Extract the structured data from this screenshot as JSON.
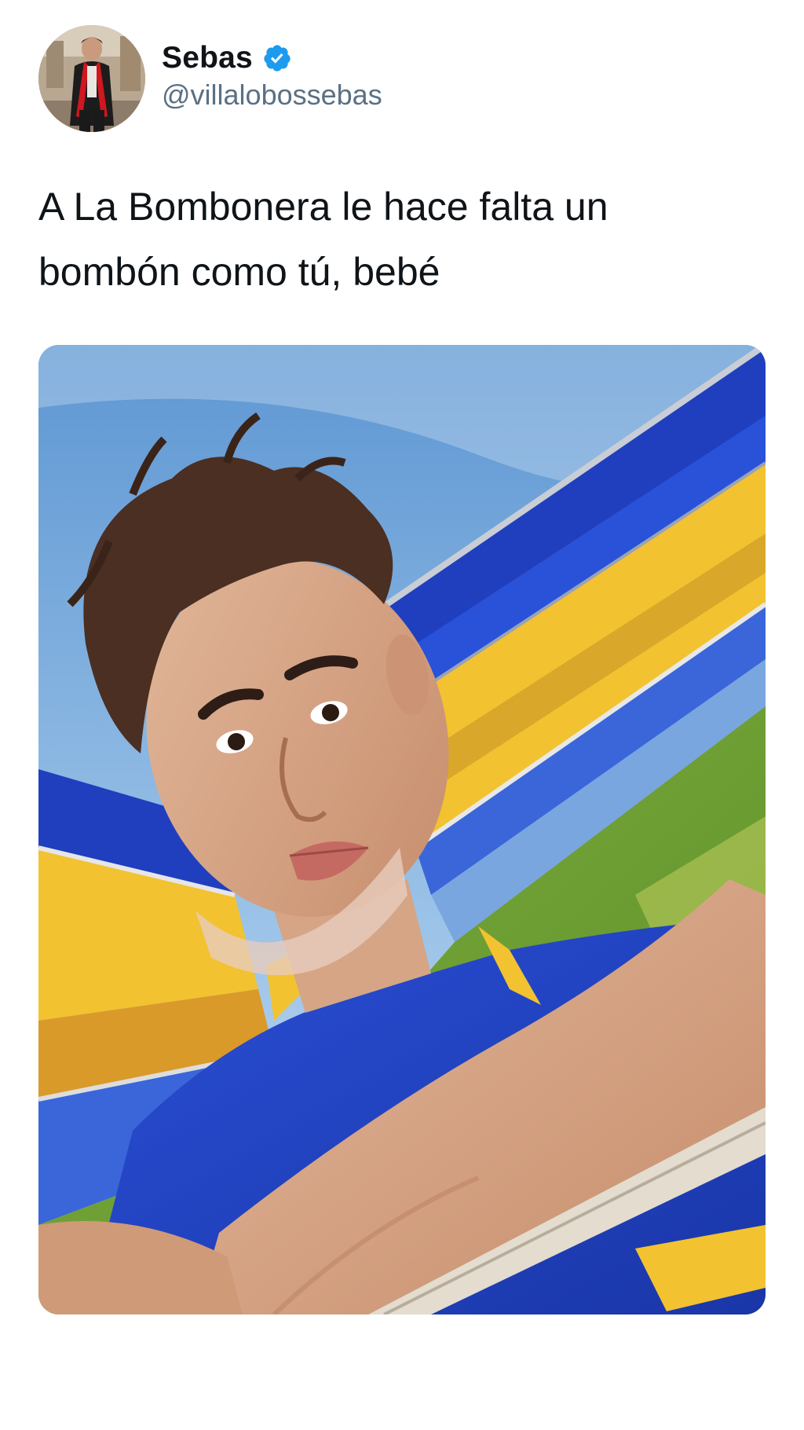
{
  "tweet": {
    "author": {
      "display_name": "Sebas",
      "handle": "@villalobossebas",
      "verified": true,
      "verified_icon": "verified-badge-icon",
      "avatar_icon": "profile-avatar"
    },
    "text": "A La Bombonera le hace falta un\nbombón como tú, bebé",
    "media": {
      "type": "photo",
      "icon": "selfie-photo"
    }
  },
  "colors": {
    "text_primary": "#0f1419",
    "text_secondary": "#5b7083",
    "verified_blue": "#1d9bf0",
    "background": "#ffffff",
    "stadium_blue": "#1f3fbf",
    "stadium_yellow": "#f2c230"
  }
}
